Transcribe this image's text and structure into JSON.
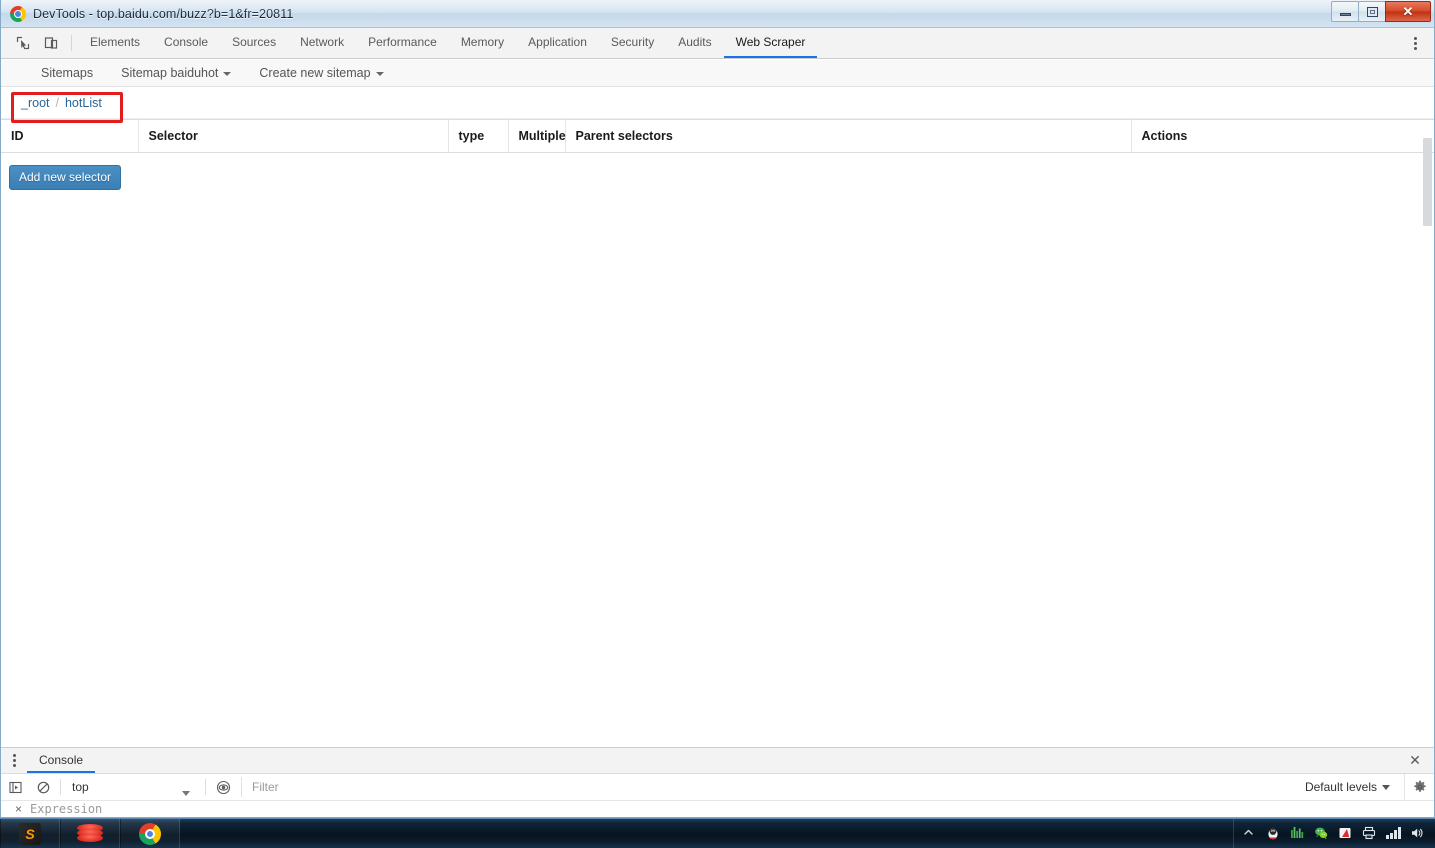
{
  "window": {
    "title": "DevTools - top.baidu.com/buzz?b=1&fr=20811",
    "logo_icon": "chrome-logo-icon",
    "controls": {
      "minimize_label": "",
      "maximize_label": "",
      "close_label": "✕"
    }
  },
  "devtools": {
    "inspect_icon": "inspect-element-icon",
    "device_toolbar_icon": "device-toolbar-icon",
    "more_icon": "kebab-menu-icon",
    "tabs": [
      {
        "label": "Elements",
        "active": false
      },
      {
        "label": "Console",
        "active": false
      },
      {
        "label": "Sources",
        "active": false
      },
      {
        "label": "Network",
        "active": false
      },
      {
        "label": "Performance",
        "active": false
      },
      {
        "label": "Memory",
        "active": false
      },
      {
        "label": "Application",
        "active": false
      },
      {
        "label": "Security",
        "active": false
      },
      {
        "label": "Audits",
        "active": false
      },
      {
        "label": "Web Scraper",
        "active": true
      }
    ]
  },
  "web_scraper": {
    "nav": [
      {
        "label": "Sitemaps",
        "caret": false
      },
      {
        "label": "Sitemap baiduhot",
        "caret": true
      },
      {
        "label": "Create new sitemap",
        "caret": true
      }
    ],
    "breadcrumb": {
      "root": "_root",
      "separator": "/",
      "current": "hotList",
      "highlight_color": "#e31d1d"
    },
    "table": {
      "columns": [
        "ID",
        "Selector",
        "type",
        "Multiple",
        "Parent selectors",
        "Actions"
      ],
      "rows": []
    },
    "add_selector_label": "Add new selector",
    "add_selector_color": "#3b80b6"
  },
  "drawer": {
    "kebab_icon": "kebab-menu-icon",
    "tab_label": "Console",
    "close_icon": "✕",
    "toolbar": {
      "execute_icon": "execution-context-icon",
      "clear_icon": "clear-console-icon",
      "context_value": "top",
      "eye_icon": "live-expression-eye-icon",
      "filter_placeholder": "Filter",
      "levels_label": "Default levels",
      "settings_icon": "gear-icon"
    },
    "expression": {
      "close_label": "×",
      "placeholder": "Expression"
    }
  },
  "taskbar": {
    "items": [
      {
        "icon": "sublime-text-icon",
        "glyph": "S"
      },
      {
        "icon": "redis-icon",
        "glyph": ""
      },
      {
        "icon": "chrome-icon",
        "glyph": ""
      }
    ],
    "tray": [
      {
        "icon": "show-hidden-icons-arrow-icon"
      },
      {
        "icon": "qq-penguin-icon"
      },
      {
        "icon": "audio-wave-icon"
      },
      {
        "icon": "wechat-icon"
      },
      {
        "icon": "red-flag-icon"
      },
      {
        "icon": "printer-icon"
      },
      {
        "icon": "network-signal-icon"
      },
      {
        "icon": "volume-speaker-icon"
      }
    ]
  }
}
